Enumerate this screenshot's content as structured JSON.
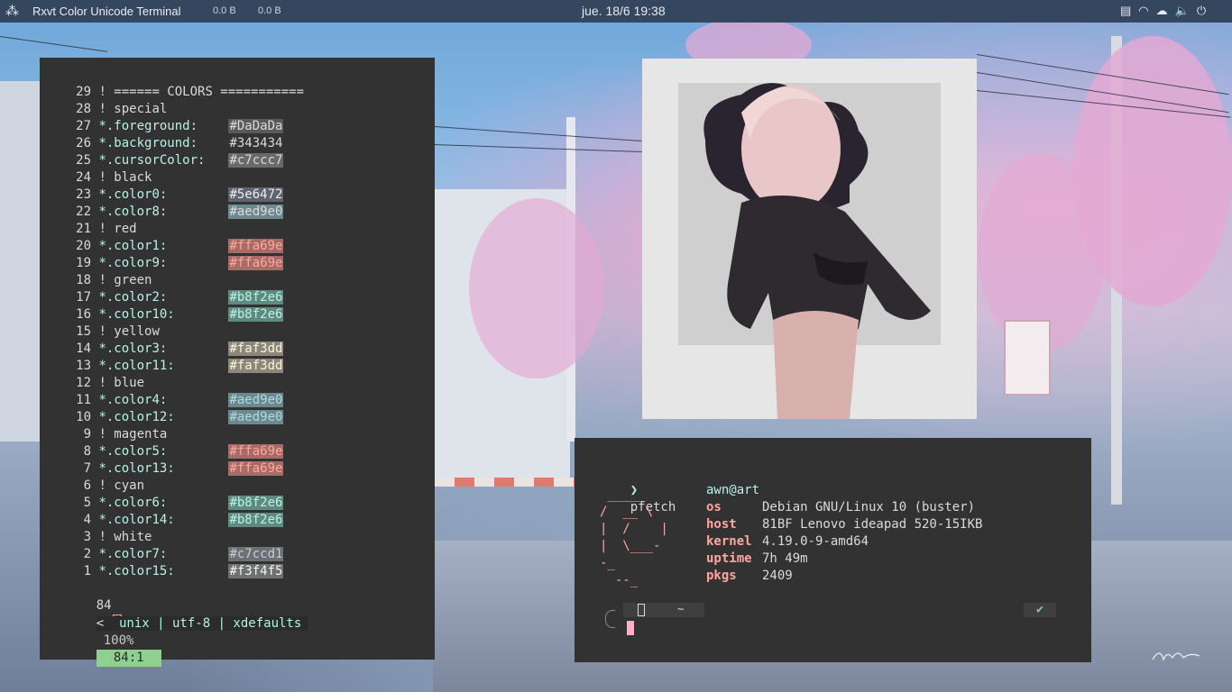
{
  "topbar": {
    "app_title": "Rxvt Color Unicode Terminal",
    "net_down": "0.0 B",
    "net_up": "0.0 B",
    "clock": "jue. 18/6  19:38",
    "tray_icons": [
      "clipboard-icon",
      "wifi-icon",
      "cloud-icon",
      "volume-icon",
      "power-icon"
    ]
  },
  "editor": {
    "lines": [
      {
        "n": "29",
        "text": "! ====== COLORS ===========",
        "type": "comment"
      },
      {
        "n": "28",
        "text": "! special",
        "type": "comment"
      },
      {
        "n": "27",
        "key": "*.foreground:",
        "value": "#DaDaDa",
        "swatch": "#5a5a5a",
        "color": "#dadada"
      },
      {
        "n": "26",
        "key": "*.background:",
        "value": "#343434",
        "swatch": "#343434",
        "color": "#dadada"
      },
      {
        "n": "25",
        "key": "*.cursorColor:",
        "value": "#c7ccc7",
        "swatch": "#6a6a6a",
        "color": "#dadada"
      },
      {
        "n": "24",
        "text": "! black",
        "type": "comment"
      },
      {
        "n": "23",
        "key": "*.color0:",
        "value": "#5e6472",
        "swatch": "#5e6472",
        "color": "#ededed"
      },
      {
        "n": "22",
        "key": "*.color8:",
        "value": "#aed9e0",
        "swatch": "#6c8a8e",
        "color": "#dadada"
      },
      {
        "n": "21",
        "text": "! red",
        "type": "comment"
      },
      {
        "n": "20",
        "key": "*.color1:",
        "value": "#ffa69e",
        "swatch": "#a86c67",
        "color": "#ffa69e"
      },
      {
        "n": "19",
        "key": "*.color9:",
        "value": "#ffa69e",
        "swatch": "#a86c67",
        "color": "#ffa69e"
      },
      {
        "n": "18",
        "text": "! green",
        "type": "comment"
      },
      {
        "n": "17",
        "key": "*.color2:",
        "value": "#b8f2e6",
        "swatch": "#5e8a80",
        "color": "#b8f2e6"
      },
      {
        "n": "16",
        "key": "*.color10:",
        "value": "#b8f2e6",
        "swatch": "#5e8a80",
        "color": "#b8f2e6"
      },
      {
        "n": "15",
        "text": "! yellow",
        "type": "comment"
      },
      {
        "n": "14",
        "key": "*.color3:",
        "value": "#faf3dd",
        "swatch": "#8c877a",
        "color": "#faf3dd"
      },
      {
        "n": "13",
        "key": "*.color11:",
        "value": "#faf3dd",
        "swatch": "#8c877a",
        "color": "#faf3dd"
      },
      {
        "n": "12",
        "text": "! blue",
        "type": "comment"
      },
      {
        "n": "11",
        "key": "*.color4:",
        "value": "#aed9e0",
        "swatch": "#6c8a8e",
        "color": "#aed9e0"
      },
      {
        "n": "10",
        "key": "*.color12:",
        "value": "#aed9e0",
        "swatch": "#6c8a8e",
        "color": "#aed9e0"
      },
      {
        "n": "9",
        "text": "! magenta",
        "type": "comment"
      },
      {
        "n": "8",
        "key": "*.color5:",
        "value": "#ffa69e",
        "swatch": "#a86c67",
        "color": "#ffa69e"
      },
      {
        "n": "7",
        "key": "*.color13:",
        "value": "#ffa69e",
        "swatch": "#a86c67",
        "color": "#ffa69e"
      },
      {
        "n": "6",
        "text": "! cyan",
        "type": "comment"
      },
      {
        "n": "5",
        "key": "*.color6:",
        "value": "#b8f2e6",
        "swatch": "#5e8a80",
        "color": "#b8f2e6"
      },
      {
        "n": "4",
        "key": "*.color14:",
        "value": "#b8f2e6",
        "swatch": "#5e8a80",
        "color": "#b8f2e6"
      },
      {
        "n": "3",
        "text": "! white",
        "type": "comment"
      },
      {
        "n": "2",
        "key": "*.color7:",
        "value": "#c7ccd1",
        "swatch": "#6d7074",
        "color": "#c7ccd1"
      },
      {
        "n": "1",
        "key": "*.color15:",
        "value": "#f3f4f5",
        "swatch": "#6f7070",
        "color": "#f3f4f5"
      }
    ],
    "current_line": "84",
    "status": {
      "left": "<  unix | utf-8 | xdefaults",
      "percent": "100%",
      "position": "84:1"
    }
  },
  "fetch": {
    "prompt_symbol": "❯",
    "command": "pfetch",
    "user": "awn@art",
    "fields": [
      {
        "label": "os",
        "value": "Debian GNU/Linux 10 (buster)"
      },
      {
        "label": "host",
        "value": "81BF Lenovo ideapad 520-15IKB"
      },
      {
        "label": "kernel",
        "value": "4.19.0-9-amd64"
      },
      {
        "label": "uptime",
        "value": "7h 49m"
      },
      {
        "label": "pkgs",
        "value": "2409"
      }
    ],
    "logo": [
      " _____",
      "/  __ \\",
      "|  /    |",
      "|  \\___-",
      "-_",
      "  --_"
    ],
    "prompt_dir": "~",
    "prompt_ok": "✔"
  },
  "colors": {
    "accent_green": "#b8f2e6",
    "status_green": "#8fcf8f",
    "cursor_pink": "#ffb0c8",
    "label_pink": "#ffa69e"
  }
}
